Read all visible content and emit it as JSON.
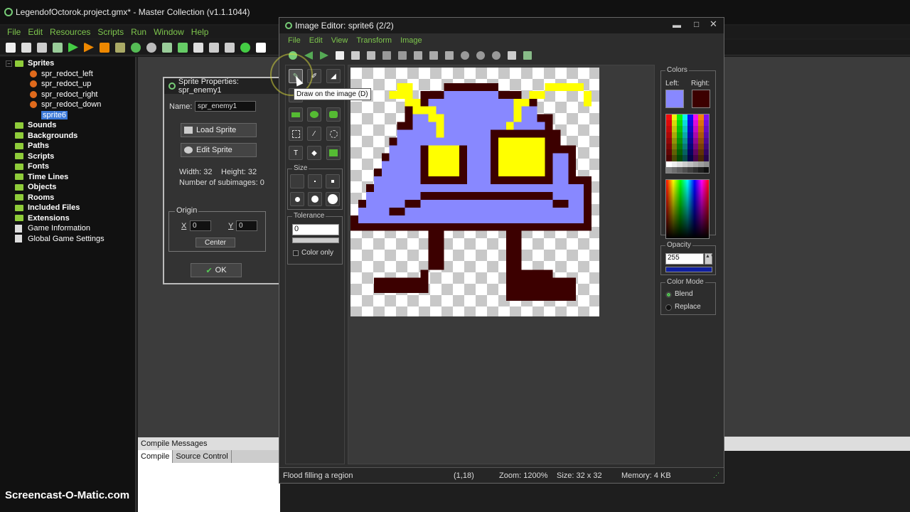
{
  "window": {
    "title": "LegendofOctorok.project.gmx* - Master Collection (v1.1.1044)"
  },
  "menu": [
    "File",
    "Edit",
    "Resources",
    "Scripts",
    "Run",
    "Window",
    "Help"
  ],
  "tree": {
    "sprites_label": "Sprites",
    "sprites": [
      "spr_redoct_left",
      "spr_redoct_up",
      "spr_redoct_right",
      "spr_redoct_down",
      "sprite6"
    ],
    "folders": [
      "Sounds",
      "Backgrounds",
      "Paths",
      "Scripts",
      "Fonts",
      "Time Lines",
      "Objects",
      "Rooms",
      "Included Files",
      "Extensions"
    ],
    "game_info": "Game Information",
    "global_settings": "Global Game Settings"
  },
  "sprite_props": {
    "title": "Sprite Properties: spr_enemy1",
    "name_label": "Name:",
    "name_value": "spr_enemy1",
    "load_sprite": "Load Sprite",
    "edit_sprite": "Edit Sprite",
    "width_label": "Width: 32",
    "height_label": "Height: 32",
    "subimages": "Number of subimages: 0",
    "origin_label": "Origin",
    "x_label": "X",
    "x_value": "0",
    "y_label": "Y",
    "y_value": "0",
    "center": "Center",
    "ok": "OK"
  },
  "compile": {
    "title": "Compile Messages",
    "tab_compile": "Compile",
    "tab_source": "Source Control"
  },
  "image_editor": {
    "title": "Image Editor: sprite6 (2/2)",
    "menu": [
      "File",
      "Edit",
      "View",
      "Transform",
      "Image"
    ],
    "size_label": "Size",
    "tolerance_label": "Tolerance",
    "tolerance_value": "0",
    "color_only": "Color only",
    "colors_label": "Colors",
    "left_label": "Left:",
    "right_label": "Right:",
    "left_color": "#8888ff",
    "right_color": "#3c0000",
    "opacity_label": "Opacity",
    "opacity_value": "255",
    "color_mode_label": "Color Mode",
    "blend": "Blend",
    "replace": "Replace",
    "tooltip": "Draw on the image (D)",
    "status": {
      "message": "Flood filling a region",
      "coords": "(1,18)",
      "zoom": "Zoom: 1200%",
      "size": "Size: 32 x 32",
      "memory": "Memory: 4 KB"
    }
  },
  "watermark": "Screencast-O-Matic.com",
  "colors": {
    "accent_green": "#7ec64d",
    "sprite_body": "#8888ff",
    "outline": "#3c0000",
    "eyes": "#ffff00"
  }
}
